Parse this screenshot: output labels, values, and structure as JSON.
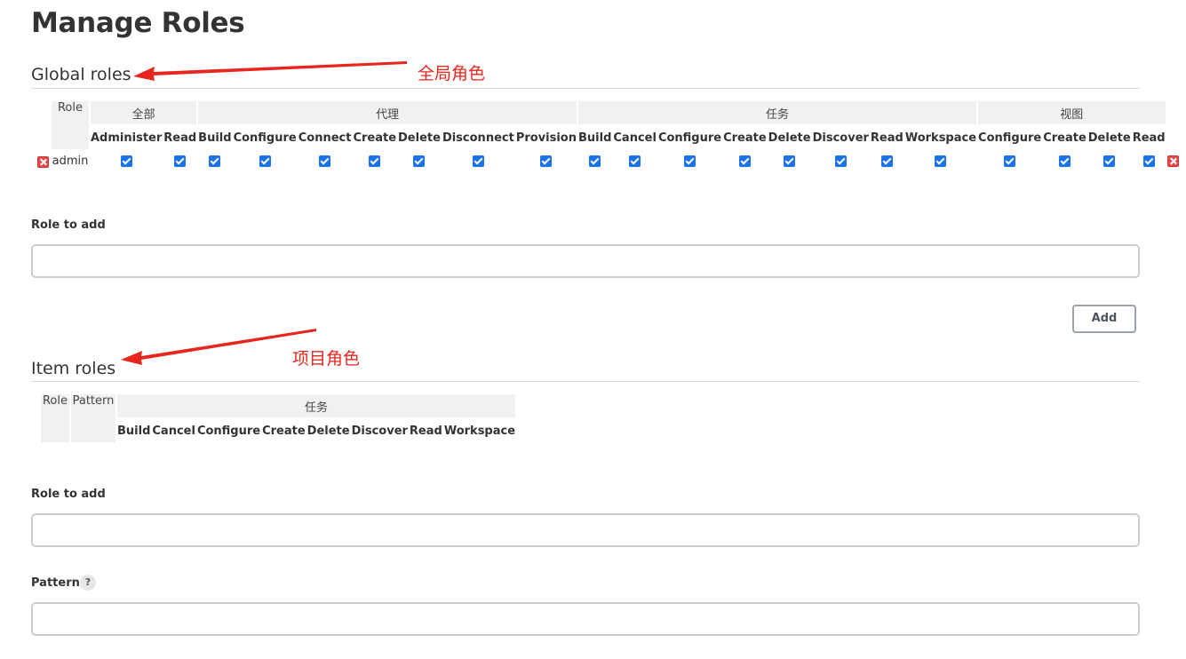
{
  "page": {
    "title": "Manage Roles"
  },
  "global_roles": {
    "section_title": "Global roles",
    "annotation": "全局角色",
    "role_header": "Role",
    "groups": [
      {
        "name": "全部",
        "permissions": [
          "Administer",
          "Read"
        ]
      },
      {
        "name": "代理",
        "permissions": [
          "Build",
          "Configure",
          "Connect",
          "Create",
          "Delete",
          "Disconnect",
          "Provision"
        ]
      },
      {
        "name": "任务",
        "permissions": [
          "Build",
          "Cancel",
          "Configure",
          "Create",
          "Delete",
          "Discover",
          "Read",
          "Workspace"
        ]
      },
      {
        "name": "视图",
        "permissions": [
          "Configure",
          "Create",
          "Delete",
          "Read"
        ]
      }
    ],
    "rows": [
      {
        "role": "admin",
        "checked_all": true
      }
    ],
    "role_to_add_label": "Role to add",
    "role_to_add_value": "",
    "add_button": "Add"
  },
  "item_roles": {
    "section_title": "Item roles",
    "annotation": "项目角色",
    "role_header": "Role",
    "pattern_header": "Pattern",
    "groups": [
      {
        "name": "任务",
        "permissions": [
          "Build",
          "Cancel",
          "Configure",
          "Create",
          "Delete",
          "Discover",
          "Read",
          "Workspace"
        ]
      }
    ],
    "role_to_add_label": "Role to add",
    "role_to_add_value": "",
    "pattern_label": "Pattern",
    "pattern_help": "?",
    "pattern_value": ""
  },
  "colors": {
    "annotation_red": "#e8261d",
    "checkbox_blue": "#1a73e8",
    "header_gray": "#f1f1f1"
  }
}
